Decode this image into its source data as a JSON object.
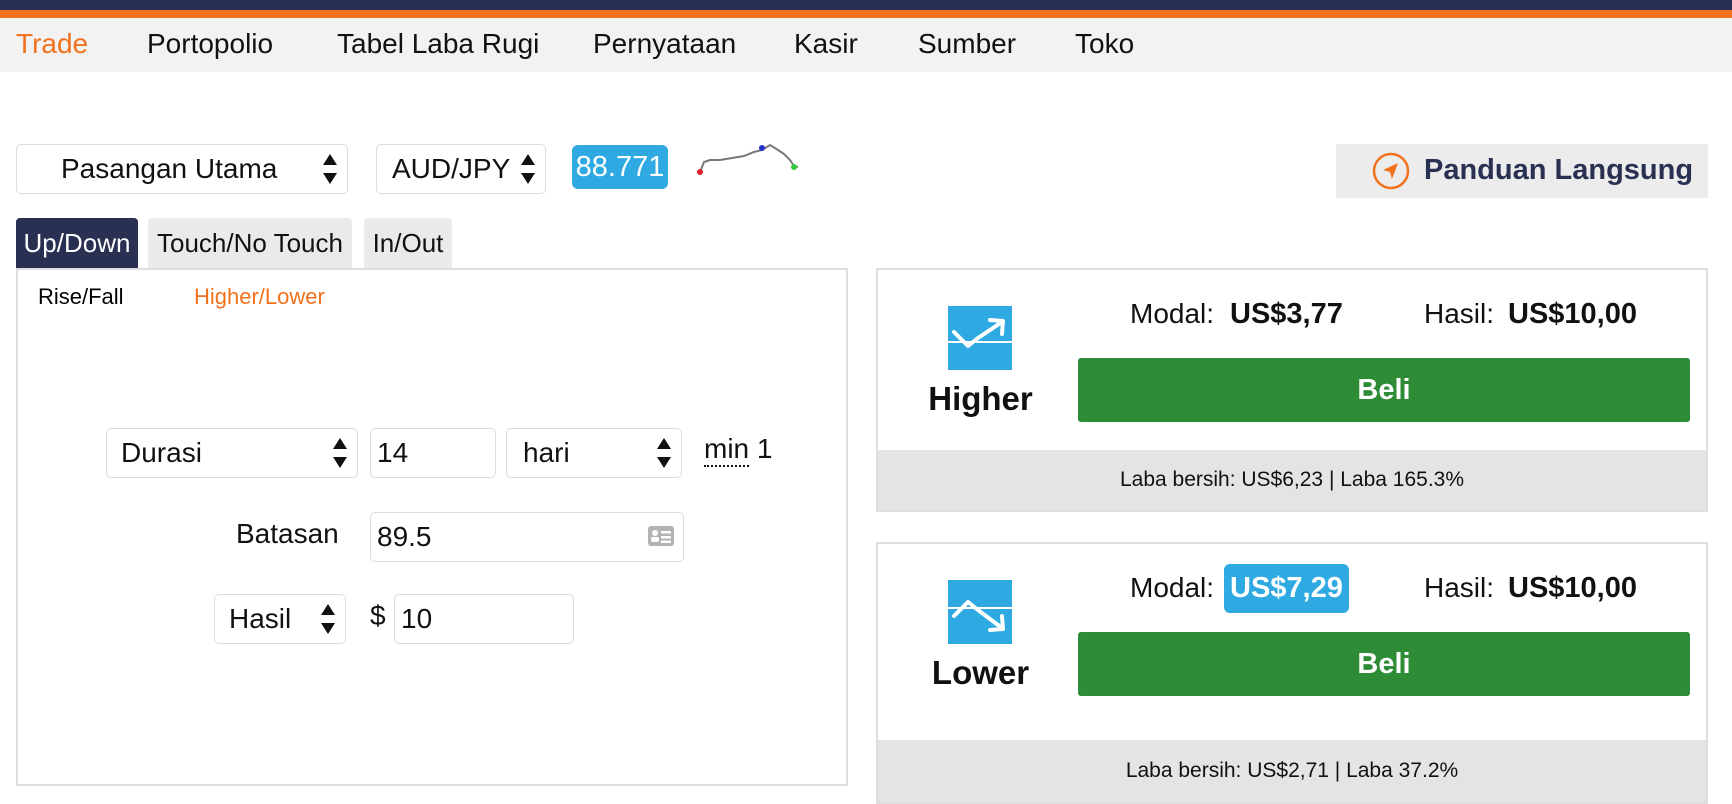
{
  "nav": {
    "items": [
      {
        "label": "Trade",
        "active": true
      },
      {
        "label": "Portopolio"
      },
      {
        "label": "Tabel Laba Rugi"
      },
      {
        "label": "Pernyataan"
      },
      {
        "label": "Kasir"
      },
      {
        "label": "Sumber"
      },
      {
        "label": "Toko"
      }
    ]
  },
  "market": {
    "group": "Pasangan Utama",
    "symbol": "AUD/JPY",
    "price": "88.771"
  },
  "guide": {
    "label": "Panduan Langsung",
    "icon": "navigation-arrow-icon"
  },
  "tabs": [
    {
      "label": "Up/Down",
      "active": true
    },
    {
      "label": "Touch/No Touch"
    },
    {
      "label": "In/Out"
    }
  ],
  "subtabs": [
    {
      "label": "Rise/Fall"
    },
    {
      "label": "Higher/Lower",
      "active": true
    }
  ],
  "form": {
    "duration_type": "Durasi",
    "duration_value": "14",
    "duration_unit": "hari",
    "min_note": "min",
    "min_value": "1",
    "barrier_label": "Batasan",
    "barrier_value": "89.5",
    "basis": "Hasil",
    "currency_symbol": "$",
    "amount": "10"
  },
  "contracts": {
    "higher": {
      "name": "Higher",
      "icon": "trend-up-icon",
      "stake_label": "Modal:",
      "stake_value": "US$3,77",
      "payout_label": "Hasil:",
      "payout_value": "US$10,00",
      "buy_label": "Beli",
      "profit_text": "Laba bersih: US$6,23 | Laba 165.3%"
    },
    "lower": {
      "name": "Lower",
      "icon": "trend-down-icon",
      "stake_label": "Modal:",
      "stake_value": "US$7,29",
      "payout_label": "Hasil:",
      "payout_value": "US$10,00",
      "buy_label": "Beli",
      "profit_text": "Laba bersih: US$2,71 | Laba 37.2%"
    }
  },
  "colors": {
    "brand_dark": "#2a3052",
    "accent_orange": "#f2711c",
    "highlight_blue": "#2ea9e1",
    "buy_green": "#2e8b36"
  }
}
